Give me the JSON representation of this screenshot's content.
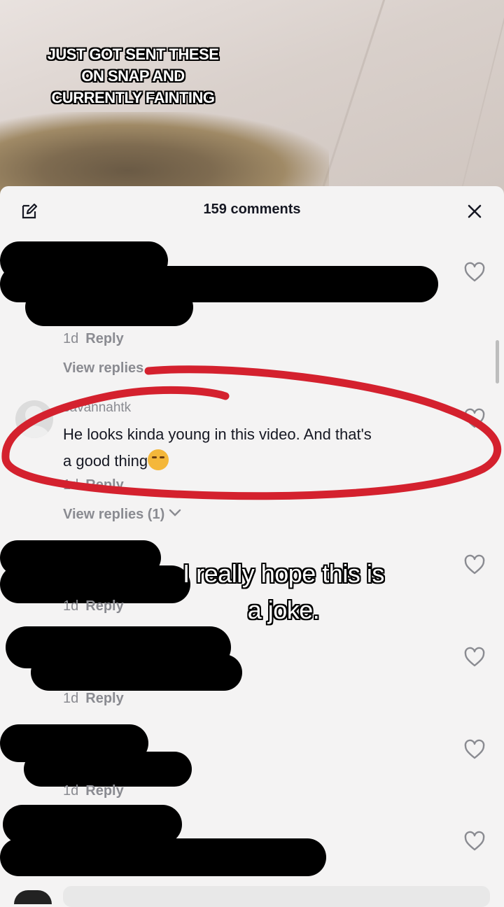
{
  "video": {
    "caption_lines": [
      "JUST GOT SENT THESE",
      "ON SNAP AND",
      "CURRENTLY FAINTING"
    ]
  },
  "sheet": {
    "title": "159 comments"
  },
  "comments": [
    {
      "time": "1d",
      "reply": "Reply",
      "view_replies": "View replies"
    },
    {
      "username": "savannahtk",
      "text_line1": "He looks kinda young in this video. And that's",
      "text_line2": "a good thing",
      "emoji": "smirking-face-emoji",
      "time": "1d",
      "reply": "Reply",
      "view_replies": "View replies (1)"
    },
    {
      "time": "1d",
      "reply": "Reply"
    },
    {
      "time": "1d",
      "reply": "Reply"
    },
    {
      "time": "1d",
      "reply": "Reply"
    }
  ],
  "overlay": {
    "subtitle_line1": "I really hope this is",
    "subtitle_line2": "a joke."
  },
  "colors": {
    "annotation_red": "#d4212e",
    "redaction": "#000000",
    "text_primary": "#161823",
    "text_secondary": "#8a8b91"
  },
  "icons": [
    "edit-icon",
    "close-icon",
    "heart-icon",
    "chevron-down-icon"
  ]
}
